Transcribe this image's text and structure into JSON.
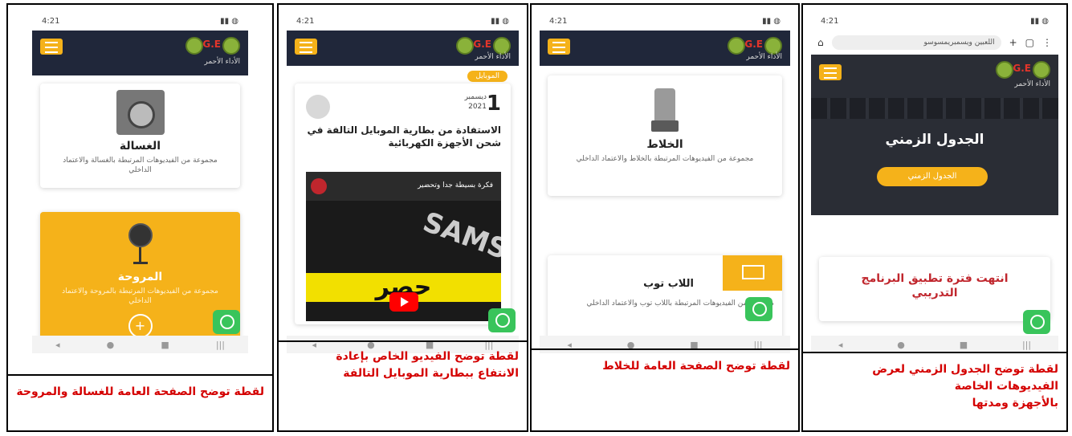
{
  "colors": {
    "accent": "#f5b21a",
    "dark": "#20273a",
    "caption": "#d40000",
    "whatsapp": "#39c45b",
    "logo": "#e2352a"
  },
  "common": {
    "brand": "G.E",
    "app_subtitle": "الأداء الأحمر",
    "navbar_icons": [
      "◂",
      "●",
      "■",
      "|||"
    ]
  },
  "panels": [
    {
      "id": "timetable",
      "browser_url": "اللعبين ويسمبريمسوسو",
      "hero_title": "الجدول الزمني",
      "hero_button": "الجدول الزمني",
      "notice": "انتهت فترة تطبيق البرنامج التدريبي",
      "caption_lines": [
        "لقطة توضح الجدول الزمني لعرض",
        "الفيديوهات الخاصة",
        "بالأجهزة ومدتها"
      ]
    },
    {
      "id": "blender",
      "card1_title": "الخلاط",
      "card1_desc": "مجموعة من الفيديوهات المرتبطة بالخلاط والاعتماد الداخلي",
      "card2_title": "اللاب توب",
      "card2_desc": "مجموعة من الفيديوهات المرتبطة باللاب توب والاعتماد الداخلي",
      "caption_lines": [
        "لقطة توضح الصفحة العامة للخلاط"
      ]
    },
    {
      "id": "video",
      "tag": "الموبايل",
      "day": "1",
      "month": "ديسمبر",
      "year": "2021",
      "post_title": "الاستفادة من بطارية الموبايل التالفة في شحن الأجهزة الكهربائية",
      "video_title": "فكرة بسيطة جدا وتحضير",
      "video_overlay": "حصر",
      "video_brand": "SAMS",
      "caption_lines": [
        "لقطة توضح الفيديو الخاص بإعادة",
        "الانتفاع ببطارية الموبايل التالفة"
      ]
    },
    {
      "id": "washer",
      "card1_title": "الغسالة",
      "card1_desc": "مجموعة من الفيديوهات المرتبطة بالغسالة والاعتماد الداخلي",
      "card2_title": "المروحة",
      "card2_desc": "مجموعة من الفيديوهات المرتبطة بالمروحة والاعتماد الداخلي",
      "card2_button": "+",
      "caption_lines": [
        "لقطة توضح الصفحة العامة للغسالة والمروحة"
      ]
    }
  ]
}
